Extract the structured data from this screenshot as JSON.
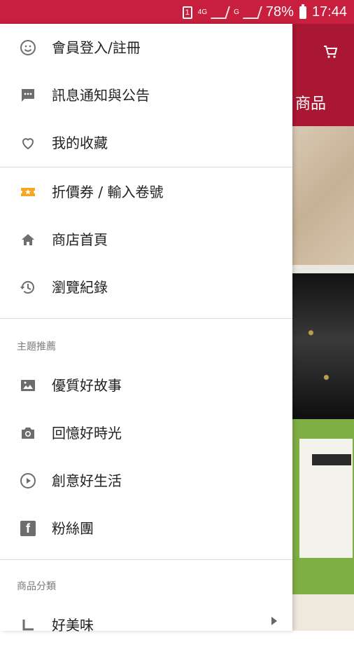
{
  "status_bar": {
    "sim_slot": "1",
    "network_4g": "4G",
    "network_g": "G",
    "battery": "78%",
    "time": "17:44"
  },
  "background": {
    "tab_partial": "商品",
    "cart_icon": "shopping-cart-icon"
  },
  "drawer": {
    "items_top": [
      {
        "icon": "smile-icon",
        "label": "會員登入/註冊"
      },
      {
        "icon": "message-icon",
        "label": "訊息通知與公告"
      },
      {
        "icon": "heart-icon",
        "label": "我的收藏"
      }
    ],
    "items_middle": [
      {
        "icon": "coupon-icon",
        "label": "折價券 / 輸入卷號"
      },
      {
        "icon": "home-icon",
        "label": "商店首頁"
      },
      {
        "icon": "history-icon",
        "label": "瀏覽紀錄"
      }
    ],
    "section_theme": "主題推薦",
    "theme_items": [
      {
        "icon": "image-icon",
        "label": "優質好故事"
      },
      {
        "icon": "camera-icon",
        "label": "回憶好時光"
      },
      {
        "icon": "play-circle-icon",
        "label": "創意好生活"
      },
      {
        "icon": "facebook-icon",
        "label": "粉絲團"
      }
    ],
    "section_category": "商品分類",
    "category_items": [
      {
        "icon": "corner-arrow-icon",
        "label": "好美味"
      }
    ]
  },
  "colors": {
    "status_red": "#c71f3d",
    "header_red": "#aa1732",
    "coupon_orange": "#f5a623",
    "icon_gray": "#6d6d6d"
  }
}
